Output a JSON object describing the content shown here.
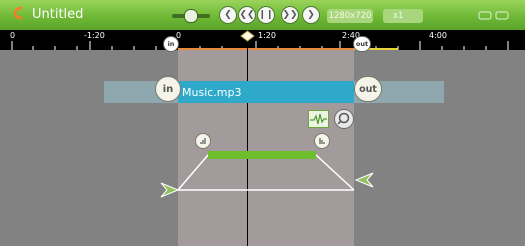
{
  "window": {
    "title": "Untitled",
    "resolution": "1280x720",
    "zoom": "x1"
  },
  "ruler": {
    "labels": [
      {
        "text": "0"
      },
      {
        "text": "-1:20"
      },
      {
        "text": "0"
      },
      {
        "text": "1:20"
      },
      {
        "text": "2:40"
      },
      {
        "text": "4:00"
      }
    ],
    "in_marker": "in",
    "out_marker": "out"
  },
  "track": {
    "file_name": "Music.mp3",
    "in_label": "in",
    "out_label": "out"
  },
  "colors": {
    "topbar": "#6fb936",
    "track_clip": "#2fa9c9",
    "selection": "#a39a9b",
    "background": "#828282",
    "accent_green": "#6dbd2d",
    "orange_line": "#e98a3f"
  },
  "icons": {
    "app": "app-logo-icon",
    "volume": "volume-slider",
    "rewind": "rewind-icon",
    "step_back": "step-back-icon",
    "pause": "pause-icon",
    "step_forward": "step-forward-icon",
    "fast_forward": "fast-forward-icon",
    "waveform": "waveform-icon",
    "search": "search-icon",
    "window": "window-controls-icon"
  }
}
